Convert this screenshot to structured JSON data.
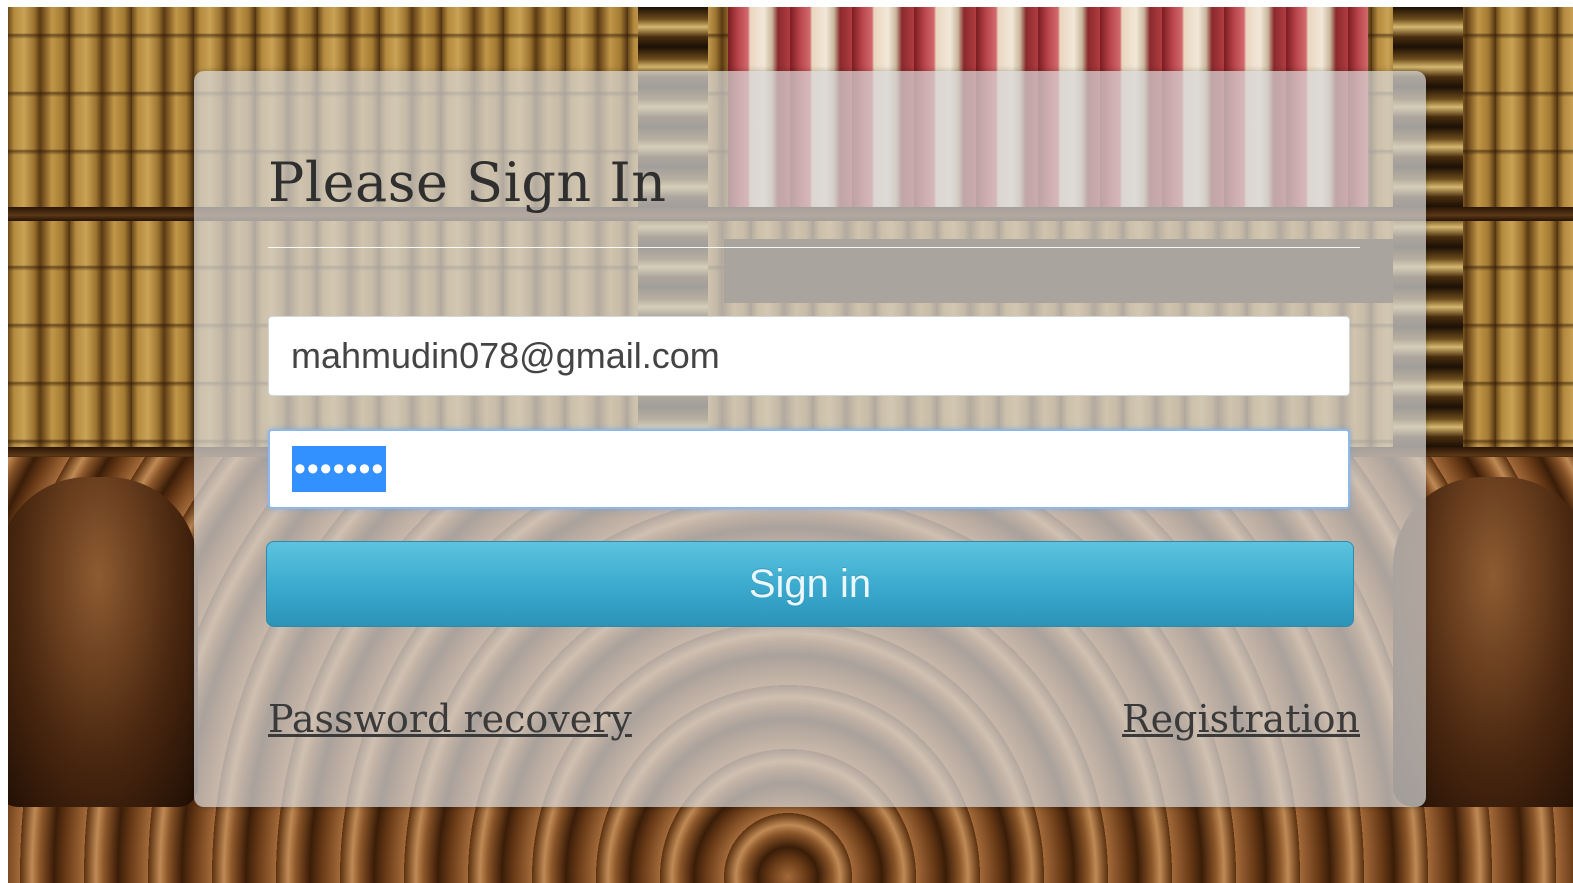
{
  "login": {
    "title": "Please Sign In",
    "email_value": "mahmudin078@gmail.com",
    "password_mask": "•••••••",
    "signin_label": "Sign in",
    "password_recovery_label": "Password recovery",
    "registration_label": "Registration"
  },
  "colors": {
    "signin_button": "#3aa9cd",
    "focus_outline": "#8fb8e6",
    "selection": "#3390ff"
  }
}
